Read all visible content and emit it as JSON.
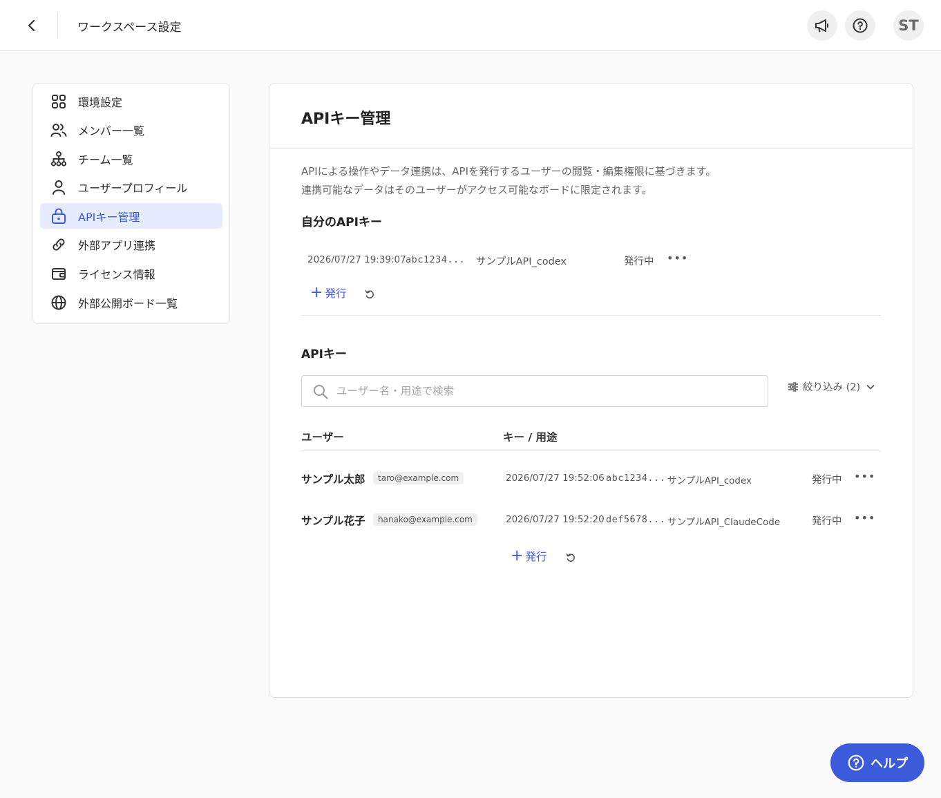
{
  "header": {
    "title": "ワークスペース設定",
    "avatar_initials": "ST",
    "icons": [
      "chevron-left-icon",
      "megaphone-icon",
      "question-circle-icon"
    ]
  },
  "sidebar": {
    "items": [
      {
        "label": "環境設定",
        "icon": "grid-icon",
        "active": false
      },
      {
        "label": "メンバー一覧",
        "icon": "users-icon",
        "active": false
      },
      {
        "label": "チーム一覧",
        "icon": "org-chart-icon",
        "active": false
      },
      {
        "label": "ユーザープロフィール",
        "icon": "user-icon",
        "active": false
      },
      {
        "label": "APIキー管理",
        "icon": "lock-icon",
        "active": true
      },
      {
        "label": "外部アプリ連携",
        "icon": "link-icon",
        "active": false
      },
      {
        "label": "ライセンス情報",
        "icon": "wallet-icon",
        "active": false
      },
      {
        "label": "外部公開ボード一覧",
        "icon": "globe-icon",
        "active": false
      }
    ]
  },
  "main": {
    "title": "APIキー管理",
    "description": [
      "APIによる操作やデータ連携は、APIを発行するユーザーの閲覧・編集権限に基づきます。",
      "連携可能なデータはそのユーザーがアクセス可能なボードに限定されます。"
    ],
    "my_keys": {
      "title": "自分のAPIキー",
      "rows": [
        {
          "date": "2026/07/27 19:39:07",
          "key": "abc1234...",
          "purpose": "サンプルAPI_codex",
          "status": "発行中"
        }
      ],
      "issue_label": "発行"
    },
    "all_keys": {
      "title": "APIキー",
      "search_placeholder": "ユーザー名・用途で検索",
      "filter_label": "絞り込み (2)",
      "columns": [
        "ユーザー",
        "キー / 用途"
      ],
      "rows": [
        {
          "user": "サンプル太郎",
          "email": "taro@example.com",
          "date": "2026/07/27 19:52:06",
          "key": "abc1234...",
          "purpose": "サンプルAPI_codex",
          "status": "発行中"
        },
        {
          "user": "サンプル花子",
          "email": "hanako@example.com",
          "date": "2026/07/27 19:52:20",
          "key": "def5678...",
          "purpose": "サンプルAPI_ClaudeCode",
          "status": "発行中"
        }
      ],
      "issue_label": "発行"
    }
  },
  "help_button": {
    "label": "ヘルプ"
  },
  "colors": {
    "accent": "#3b5bdb",
    "active_bg": "#e6ecfd",
    "border": "#e6e6e6"
  }
}
